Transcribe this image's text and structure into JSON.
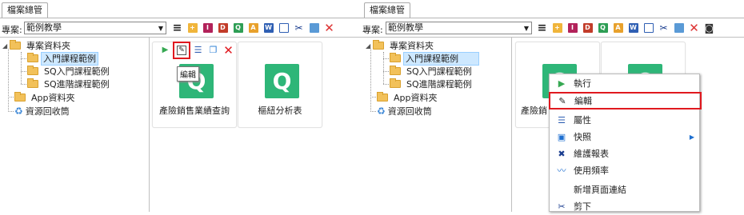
{
  "left": {
    "tab_label": "檔案總管",
    "project_label": "專案:",
    "project_value": "範例教學",
    "tree": {
      "root": "專案資料夾",
      "children": [
        "入門課程範例",
        "SQ入門課程範例",
        "SQ進階課程範例"
      ],
      "app_folder": "App資料夾",
      "recycle": "資源回收筒"
    },
    "cards": [
      {
        "title": "產險銷售業績查詢"
      },
      {
        "title": "樞紐分析表"
      }
    ],
    "card_icon_letter": "Q",
    "tooltip": "編輯"
  },
  "right": {
    "tab_label": "檔案總管",
    "project_label": "專案:",
    "project_value": "範例教學",
    "tree": {
      "root": "專案資料夾",
      "children": [
        "入門課程範例",
        "SQ入門課程範例",
        "SQ進階課程範例"
      ],
      "app_folder": "App資料夾",
      "recycle": "資源回收筒"
    },
    "card_partial_title": "產險銷",
    "card_icon_letter": "Q",
    "context_menu": [
      {
        "label": "執行",
        "icon": "play-icon"
      },
      {
        "label": "編輯",
        "icon": "edit-icon",
        "highlighted": true
      },
      {
        "label": "屬性",
        "icon": "properties-icon"
      },
      {
        "label": "快照",
        "icon": "snapshot-icon",
        "submenu": true
      },
      {
        "label": "維護報表",
        "icon": "tools-icon"
      },
      {
        "label": "使用頻率",
        "icon": "usage-icon"
      },
      {
        "label": "新增頁面連結",
        "icon": ""
      },
      {
        "label": "剪下",
        "icon": "scissors-icon"
      }
    ]
  },
  "toolbar_icons": [
    "menu-icon",
    "new-folder-icon",
    "i-icon",
    "d-icon",
    "q-icon",
    "a-icon",
    "w-icon",
    "document-icon",
    "cut-icon",
    "copy-icon",
    "delete-icon"
  ],
  "colors": {
    "highlight_red": "#e0191f",
    "card_icon_green": "#2eb678",
    "selection_blue": "#cde8ff"
  }
}
